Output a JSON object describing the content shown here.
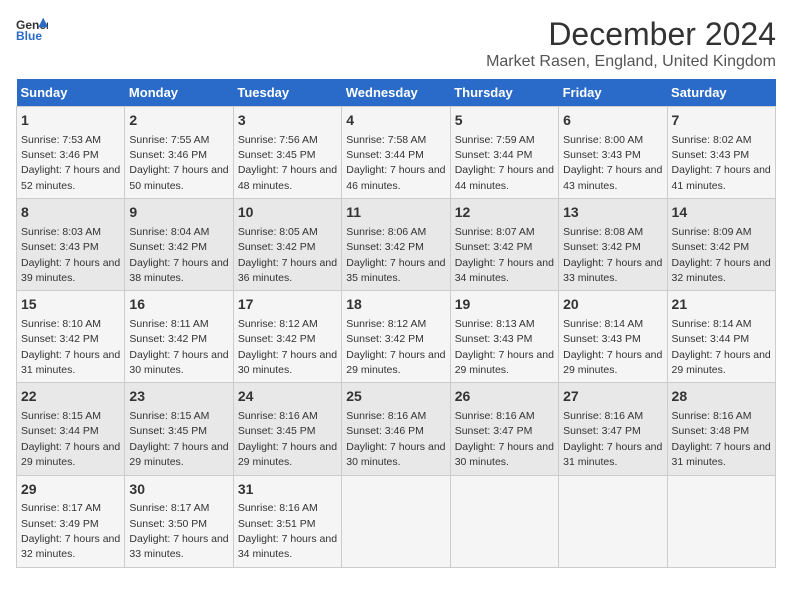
{
  "logo": {
    "line1": "General",
    "line2": "Blue"
  },
  "title": "December 2024",
  "location": "Market Rasen, England, United Kingdom",
  "days_of_week": [
    "Sunday",
    "Monday",
    "Tuesday",
    "Wednesday",
    "Thursday",
    "Friday",
    "Saturday"
  ],
  "weeks": [
    [
      {
        "day": "1",
        "sunrise": "7:53 AM",
        "sunset": "3:46 PM",
        "daylight": "7 hours and 52 minutes."
      },
      {
        "day": "2",
        "sunrise": "7:55 AM",
        "sunset": "3:46 PM",
        "daylight": "7 hours and 50 minutes."
      },
      {
        "day": "3",
        "sunrise": "7:56 AM",
        "sunset": "3:45 PM",
        "daylight": "7 hours and 48 minutes."
      },
      {
        "day": "4",
        "sunrise": "7:58 AM",
        "sunset": "3:44 PM",
        "daylight": "7 hours and 46 minutes."
      },
      {
        "day": "5",
        "sunrise": "7:59 AM",
        "sunset": "3:44 PM",
        "daylight": "7 hours and 44 minutes."
      },
      {
        "day": "6",
        "sunrise": "8:00 AM",
        "sunset": "3:43 PM",
        "daylight": "7 hours and 43 minutes."
      },
      {
        "day": "7",
        "sunrise": "8:02 AM",
        "sunset": "3:43 PM",
        "daylight": "7 hours and 41 minutes."
      }
    ],
    [
      {
        "day": "8",
        "sunrise": "8:03 AM",
        "sunset": "3:43 PM",
        "daylight": "7 hours and 39 minutes."
      },
      {
        "day": "9",
        "sunrise": "8:04 AM",
        "sunset": "3:42 PM",
        "daylight": "7 hours and 38 minutes."
      },
      {
        "day": "10",
        "sunrise": "8:05 AM",
        "sunset": "3:42 PM",
        "daylight": "7 hours and 36 minutes."
      },
      {
        "day": "11",
        "sunrise": "8:06 AM",
        "sunset": "3:42 PM",
        "daylight": "7 hours and 35 minutes."
      },
      {
        "day": "12",
        "sunrise": "8:07 AM",
        "sunset": "3:42 PM",
        "daylight": "7 hours and 34 minutes."
      },
      {
        "day": "13",
        "sunrise": "8:08 AM",
        "sunset": "3:42 PM",
        "daylight": "7 hours and 33 minutes."
      },
      {
        "day": "14",
        "sunrise": "8:09 AM",
        "sunset": "3:42 PM",
        "daylight": "7 hours and 32 minutes."
      }
    ],
    [
      {
        "day": "15",
        "sunrise": "8:10 AM",
        "sunset": "3:42 PM",
        "daylight": "7 hours and 31 minutes."
      },
      {
        "day": "16",
        "sunrise": "8:11 AM",
        "sunset": "3:42 PM",
        "daylight": "7 hours and 30 minutes."
      },
      {
        "day": "17",
        "sunrise": "8:12 AM",
        "sunset": "3:42 PM",
        "daylight": "7 hours and 30 minutes."
      },
      {
        "day": "18",
        "sunrise": "8:12 AM",
        "sunset": "3:42 PM",
        "daylight": "7 hours and 29 minutes."
      },
      {
        "day": "19",
        "sunrise": "8:13 AM",
        "sunset": "3:43 PM",
        "daylight": "7 hours and 29 minutes."
      },
      {
        "day": "20",
        "sunrise": "8:14 AM",
        "sunset": "3:43 PM",
        "daylight": "7 hours and 29 minutes."
      },
      {
        "day": "21",
        "sunrise": "8:14 AM",
        "sunset": "3:44 PM",
        "daylight": "7 hours and 29 minutes."
      }
    ],
    [
      {
        "day": "22",
        "sunrise": "8:15 AM",
        "sunset": "3:44 PM",
        "daylight": "7 hours and 29 minutes."
      },
      {
        "day": "23",
        "sunrise": "8:15 AM",
        "sunset": "3:45 PM",
        "daylight": "7 hours and 29 minutes."
      },
      {
        "day": "24",
        "sunrise": "8:16 AM",
        "sunset": "3:45 PM",
        "daylight": "7 hours and 29 minutes."
      },
      {
        "day": "25",
        "sunrise": "8:16 AM",
        "sunset": "3:46 PM",
        "daylight": "7 hours and 30 minutes."
      },
      {
        "day": "26",
        "sunrise": "8:16 AM",
        "sunset": "3:47 PM",
        "daylight": "7 hours and 30 minutes."
      },
      {
        "day": "27",
        "sunrise": "8:16 AM",
        "sunset": "3:47 PM",
        "daylight": "7 hours and 31 minutes."
      },
      {
        "day": "28",
        "sunrise": "8:16 AM",
        "sunset": "3:48 PM",
        "daylight": "7 hours and 31 minutes."
      }
    ],
    [
      {
        "day": "29",
        "sunrise": "8:17 AM",
        "sunset": "3:49 PM",
        "daylight": "7 hours and 32 minutes."
      },
      {
        "day": "30",
        "sunrise": "8:17 AM",
        "sunset": "3:50 PM",
        "daylight": "7 hours and 33 minutes."
      },
      {
        "day": "31",
        "sunrise": "8:16 AM",
        "sunset": "3:51 PM",
        "daylight": "7 hours and 34 minutes."
      },
      null,
      null,
      null,
      null
    ]
  ],
  "labels": {
    "sunrise": "Sunrise:",
    "sunset": "Sunset:",
    "daylight": "Daylight:"
  }
}
